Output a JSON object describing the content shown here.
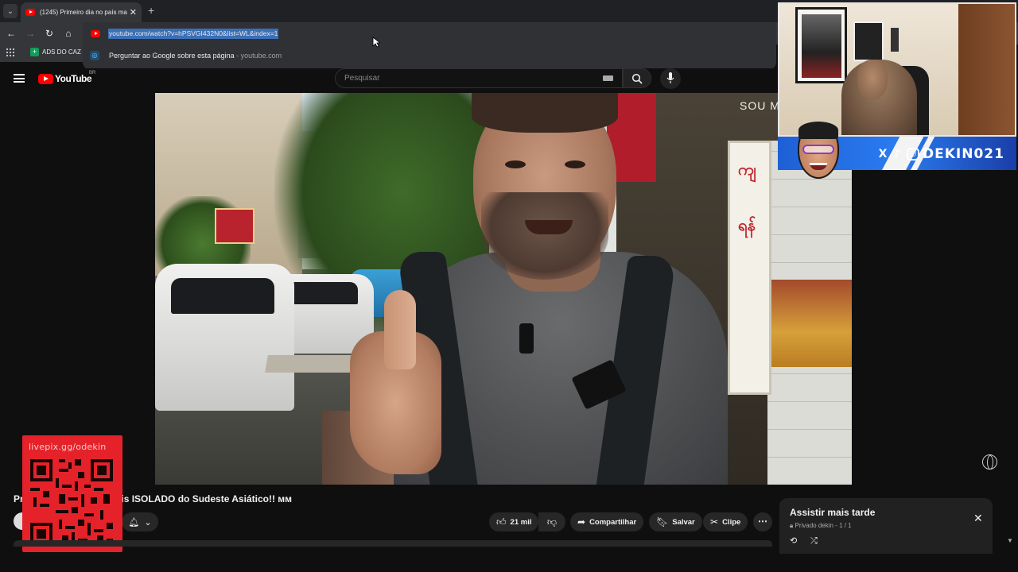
{
  "browser": {
    "tab": {
      "title": "(1245) Primeiro dia no país ma"
    },
    "omnibox": {
      "url": "youtube.com/watch?v=hPSVGI432N0&list=WL&index=1",
      "suggestion": "Perguntar ao Google sobre esta página",
      "suggestion_sep": " - ",
      "suggestion_source": "youtube.com"
    },
    "bookmarks": [
      {
        "label": "ADS DO CAZ"
      }
    ]
  },
  "youtube": {
    "logo_text": "YouTube",
    "country_code": "BR",
    "search": {
      "placeholder": "Pesquisar"
    }
  },
  "video": {
    "title_start": "Pr",
    "title_end": "ais ISOLADO do Sudeste Asiático!! ᴍᴍ",
    "scene_text": "SOU M",
    "actions": {
      "likes": "21 mil",
      "share": "Compartilhar",
      "save": "Salvar",
      "clip": "Clipe"
    }
  },
  "overlay": {
    "qr_url": "livepix.gg/odekin",
    "banner_name": "DEKIN021"
  },
  "playlist": {
    "title": "Assistir mais tarde",
    "subtitle": "Privado dekin - 1 / 1"
  },
  "colors": {
    "youtube_red": "#ff0000",
    "qr_red": "#e52229",
    "banner_blue": "#2a7cf0",
    "dark_bg": "#0f0f0f"
  },
  "icons": [
    "menu-icon",
    "search-icon",
    "mic-icon",
    "keyboard-icon",
    "like-icon",
    "dislike-icon",
    "share-icon",
    "save-icon",
    "clip-icon",
    "more-icon",
    "bell-icon",
    "close-icon",
    "loop-icon",
    "shuffle-icon",
    "globe-icon",
    "reload-icon",
    "home-icon",
    "back-icon",
    "forward-icon",
    "apps-icon"
  ]
}
